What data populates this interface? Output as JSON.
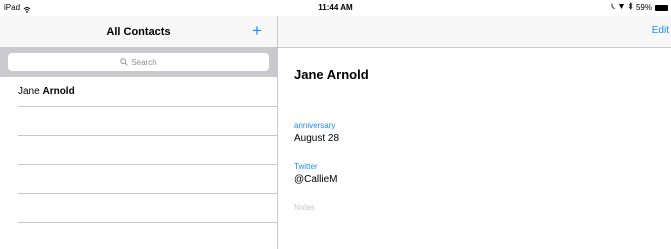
{
  "status_bar": {
    "device": "iPad",
    "time": "11:44 AM",
    "battery": "59%"
  },
  "master": {
    "title": "All Contacts",
    "add_label": "+",
    "search_placeholder": "Search",
    "contacts": [
      {
        "first": "Jane",
        "last": "Arnold"
      }
    ]
  },
  "detail": {
    "edit_label": "Edit",
    "name": "Jane Arnold",
    "fields": [
      {
        "label": "anniversary",
        "value": "August 28"
      },
      {
        "label": "Twitter",
        "value": "@CallieM"
      }
    ],
    "notes_label": "Notes"
  },
  "colors": {
    "accent": "#1a8cff",
    "separator": "#c8c7cc",
    "search_bg": "#c9c9ce",
    "placeholder": "#8e8e93"
  },
  "icons": [
    "wifi-icon",
    "bluetooth-icon",
    "battery-icon",
    "search-icon",
    "add-icon"
  ]
}
